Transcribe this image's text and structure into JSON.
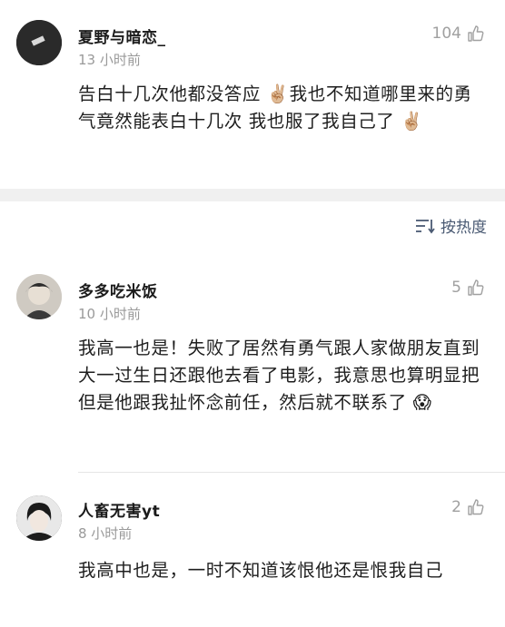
{
  "comments": [
    {
      "username": "夏野与暗恋_",
      "time": "13 小时前",
      "likes": "104",
      "content": "告白十几次他都没答应 ✌🏼我也不知道哪里来的勇气竟然能表白十几次 我也服了我自己了 ✌🏼"
    },
    {
      "username": "多多吃米饭",
      "time": "10 小时前",
      "likes": "5",
      "content": "我高一也是！失败了居然有勇气跟人家做朋友直到大一过生日还跟他去看了电影，我意思也算明显把但是他跟我扯怀念前任，然后就不联系了 😱"
    },
    {
      "username": "人畜无害yt",
      "time": "8 小时前",
      "likes": "2",
      "content": "我高中也是，一时不知道该恨他还是恨我自己"
    }
  ],
  "sort": {
    "label": "按热度",
    "icon": "sort-icon"
  },
  "icons": {
    "like": "thumbs-up-icon"
  },
  "colors": {
    "separator": "#f0f0f0",
    "meta": "#9a9a9a",
    "sort": "#4a5a73"
  }
}
